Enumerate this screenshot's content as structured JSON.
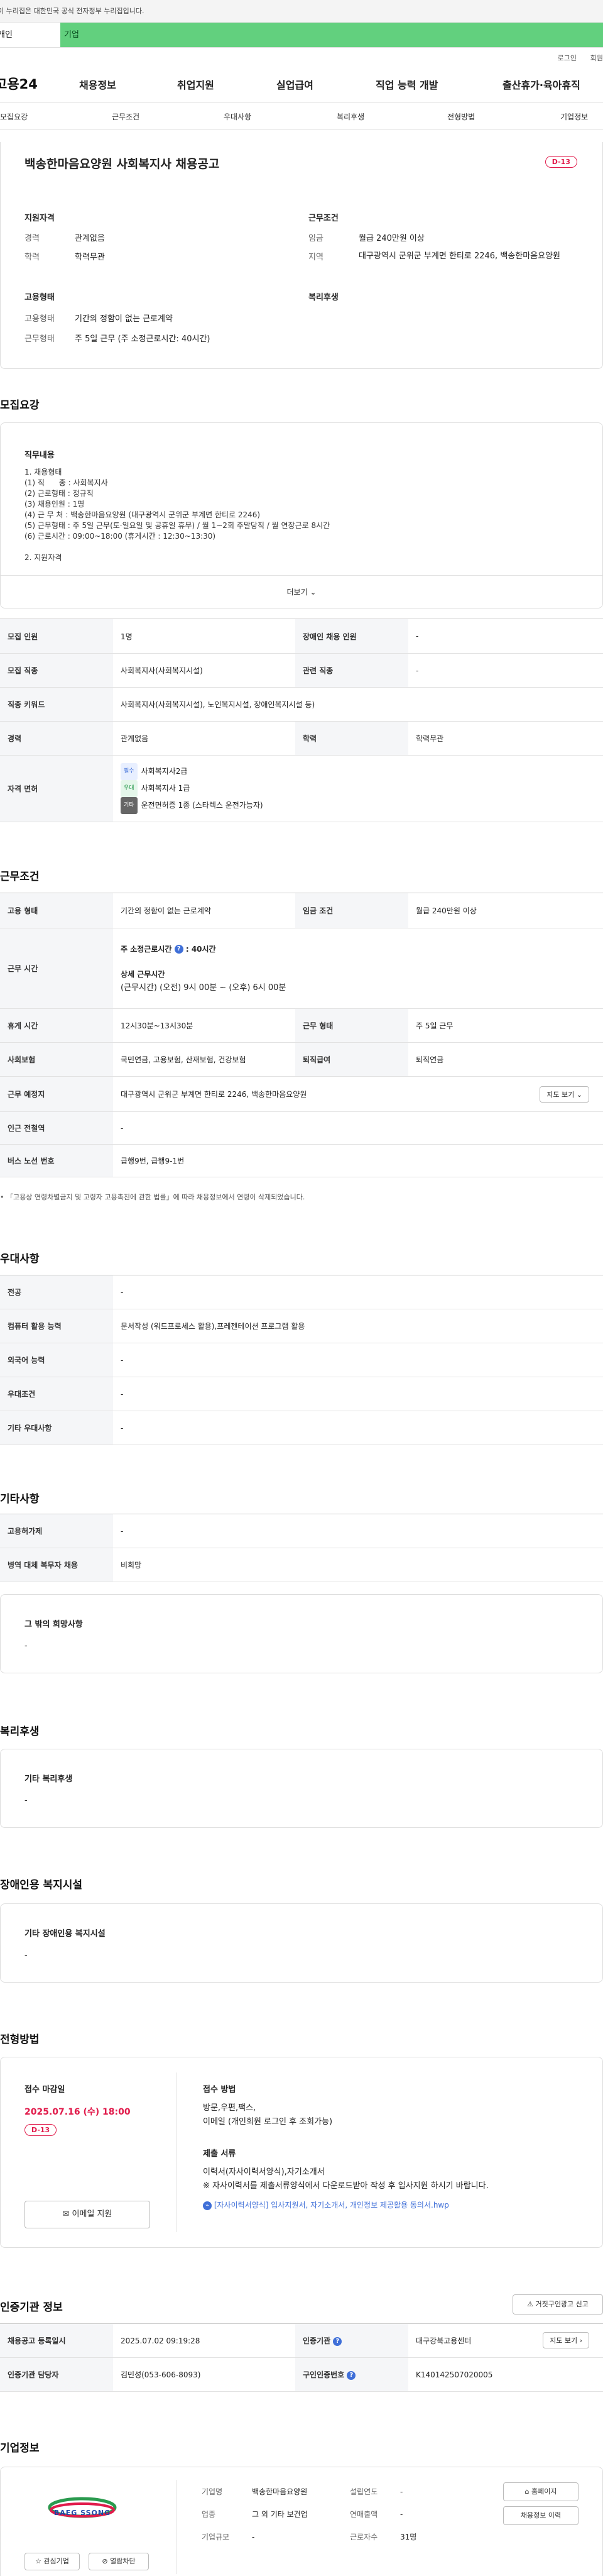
{
  "gov_banner": "이 누리집은 대한민국 공식 전자정부 누리집입니다.",
  "user_tabs": {
    "person": "개인",
    "corp": "기업"
  },
  "top_links": {
    "login": "로그인",
    "join": "회원"
  },
  "site": {
    "logo": "고용24",
    "menu": [
      "채용정보",
      "취업지원",
      "실업급여",
      "직업 능력 개발",
      "출산휴가·육아휴직"
    ]
  },
  "subnav": [
    "모집요강",
    "근무조건",
    "우대사항",
    "복리후생",
    "전형방법",
    "기업정보"
  ],
  "job": {
    "title": "백송한마음요양원 사회복지사 채용공고",
    "dday": "D-13",
    "summary": {
      "qual_title": "지원자격",
      "career_k": "경력",
      "career_v": "관계없음",
      "edu_k": "학력",
      "edu_v": "학력무관",
      "cond_title": "근무조건",
      "wage_k": "임금",
      "wage_v": "월급 240만원 이상",
      "loc_k": "지역",
      "loc_v": "대구광역시 군위군 부계면 한티로 2246, 백송한마음요양원",
      "emp_title": "고용형태",
      "etype_k": "고용형태",
      "etype_v": "기간의 정함이 없는 근로계약",
      "wtype_k": "근무형태",
      "wtype_v": "주 5일 근무 (주 소정근로시간: 40시간)",
      "welfare_title": "복리후생"
    }
  },
  "recruit": {
    "title": "모집요강",
    "duty_title": "직무내용",
    "duty_lines": [
      "1. 채용형태",
      "(1) 직      종 : 사회복지사",
      "(2) 근로형태 : 정규직",
      "(3) 채용인원 : 1명",
      "(4) 근 무 처 : 백송한마음요양원 (대구광역시 군위군 부계면 한티로 2246)",
      "(5) 근무형태 : 주 5일 근무(토·일요일 및 공휴일 휴무) / 월 1~2회 주말당직 / 월 연장근로 8시간",
      "(6) 근로시간 : 09:00~18:00 (휴게시간 : 12:30~13:30)",
      "",
      "2. 지원자격"
    ],
    "more": "더보기",
    "rows": {
      "count_k": "모집 인원",
      "count_v": "1명",
      "disabled_k": "장애인 채용 인원",
      "disabled_v": "-",
      "job_k": "모집 직종",
      "job_v": "사회복지사(사회복지시설)",
      "rel_k": "관련 직종",
      "rel_v": "-",
      "kw_k": "직종 키워드",
      "kw_v": "사회복지사(사회복지시설), 노인복지시설, 장애인복지시설 등)",
      "career_k": "경력",
      "career_v": "관계없음",
      "edu_k": "학력",
      "edu_v": "학력무관",
      "lic_k": "자격 면허",
      "lic": [
        {
          "tag": "필수",
          "name": "사회복지사2급"
        },
        {
          "tag": "우대",
          "name": "사회복지사 1급"
        },
        {
          "tag": "기타",
          "name": "운전면허증 1종 (스타렉스 운전가능자)"
        }
      ]
    }
  },
  "work": {
    "title": "근무조건",
    "etype_k": "고용 형태",
    "etype_v": "기간의 정함이 없는 근로계약",
    "wage_k": "임금 조건",
    "wage_v": "월급 240만원 이상",
    "hours_k": "근무 시간",
    "hours_sub1": "주 소정근로시간",
    "hours_val": ": 40시간",
    "hours_sub2": "상세 근무시간",
    "hours_detail": "(근무시간) (오전) 9시 00분 ~ (오후) 6시 00분",
    "break_k": "휴게 시간",
    "break_v": "12시30분~13시30분",
    "wform_k": "근무 형태",
    "wform_v": "주 5일 근무",
    "ins_k": "사회보험",
    "ins_v": "국민연금, 고용보험, 산재보험, 건강보험",
    "ret_k": "퇴직급여",
    "ret_v": "퇴직연금",
    "place_k": "근무 예정지",
    "place_v": "대구광역시 군위군 부계면 한티로 2246, 백송한마음요양원",
    "map_btn": "지도 보기",
    "subway_k": "인근 전철역",
    "subway_v": "-",
    "bus_k": "버스 노선 번호",
    "bus_v": "급행9번, 급행9-1번",
    "note": "「고용상 연령차별금지 및 고령자 고용촉진에 관한 법률」에 따라 채용정보에서 연령이 삭제되었습니다."
  },
  "pref": {
    "title": "우대사항",
    "major_k": "전공",
    "major_v": "-",
    "pc_k": "컴퓨터 활용 능력",
    "pc_v": "문서작성 (워드프로세스 활용),프레젠테이션 프로그램 활용",
    "lang_k": "외국어 능력",
    "lang_v": "-",
    "cond_k": "우대조건",
    "cond_v": "-",
    "etc_k": "기타 우대사항",
    "etc_v": "-"
  },
  "other": {
    "title": "기타사항",
    "permit_k": "고용허가제",
    "permit_v": "-",
    "military_k": "병역 대체 복무자 채용",
    "military_v": "비희망",
    "wish_title": "그 밖의 희망사항",
    "wish_v": "-"
  },
  "welfare": {
    "title": "복리후생",
    "box_title": "기타 복리후생",
    "box_v": "-"
  },
  "facility": {
    "title": "장애인용 복지시설",
    "box_title": "기타 장애인용 복지시설",
    "box_v": "-"
  },
  "selection": {
    "title": "전형방법",
    "deadline_title": "접수 마감일",
    "deadline": "2025.07.16 (수) 18:00",
    "dday": "D-13",
    "email_btn": "이메일 지원",
    "method_title": "접수 방법",
    "method_v1": "방문,우편,팩스,",
    "method_v2": "이메일 (개인회원 로그인 후 조회가능)",
    "docs_title": "제출 서류",
    "docs_v1": "이력서(자사이력서양식),자기소개서",
    "docs_v2": "※ 자사이력서를 제출서류양식에서 다운로드받아 작성 후 입사지원 하시기 바랍니다.",
    "docs_file": "[자사이력서양식] 입사지원서, 자기소개서, 개인정보 제공활용 동의서.hwp"
  },
  "cert": {
    "title": "인증기관 정보",
    "report_btn": "거짓구인광고 신고",
    "reg_k": "채용공고 등록일시",
    "reg_v": "2025.07.02 09:19:28",
    "org_k": "인증기관",
    "org_v": "대구강북고용센터",
    "map_btn": "지도 보기",
    "mgr_k": "인증기관 담당자",
    "mgr_v": "김민성(053-606-8093)",
    "no_k": "구인인증번호",
    "no_v": "K140142507020005"
  },
  "company": {
    "title": "기업정보",
    "logo_text": "BAEG SSONG",
    "fav_btn": "관심기업",
    "block_btn": "열람차단",
    "name_k": "기업명",
    "name_v": "백송한마음요양원",
    "founded_k": "설립연도",
    "founded_v": "-",
    "ind_k": "업종",
    "ind_v": "그 외 기타 보건업",
    "sales_k": "연매출액",
    "sales_v": "-",
    "size_k": "기업규모",
    "size_v": "-",
    "staff_k": "근로자수",
    "staff_v": "31명",
    "home_btn": "홈페이지",
    "jobs_btn": "채용정보 이력"
  }
}
